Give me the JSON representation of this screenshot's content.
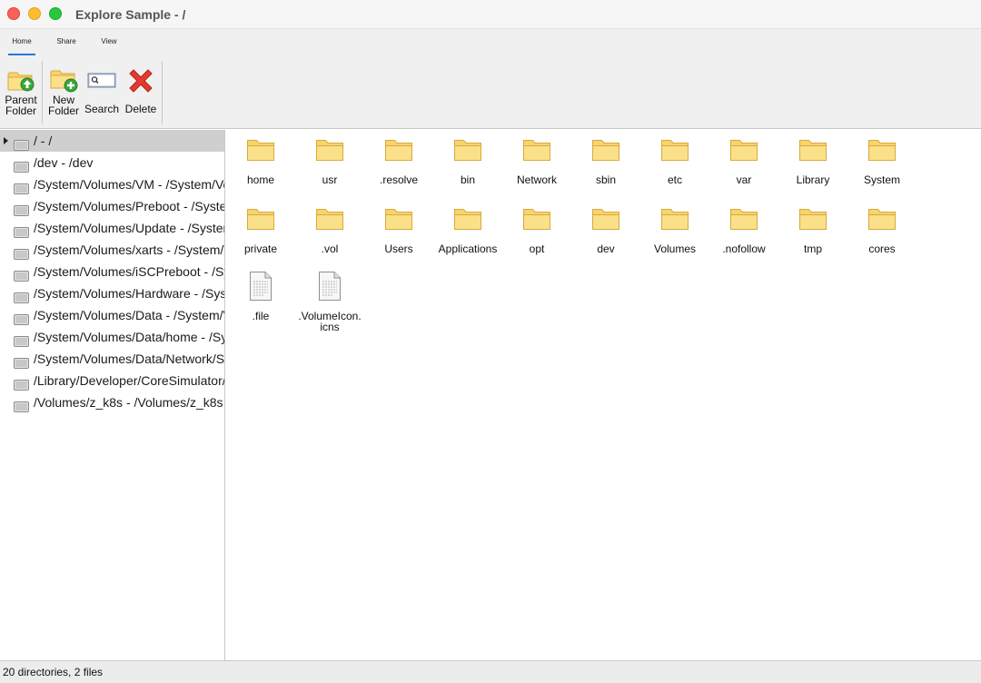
{
  "window": {
    "title": "Explore Sample - /"
  },
  "ribbon": {
    "tabs": [
      {
        "label": "Home",
        "active": true
      },
      {
        "label": "Share",
        "active": false
      },
      {
        "label": "View",
        "active": false
      }
    ],
    "buttons": {
      "parent_line1": "Parent",
      "parent_line2": "Folder",
      "new_line1": "New",
      "new_line2": "Folder",
      "search": "Search",
      "delete": "Delete"
    }
  },
  "tree": {
    "items": [
      {
        "label": "/ - /",
        "selected": true
      },
      {
        "label": "/dev - /dev"
      },
      {
        "label": "/System/Volumes/VM - /System/Volumes/VM"
      },
      {
        "label": "/System/Volumes/Preboot - /System/Volumes/Preboot"
      },
      {
        "label": "/System/Volumes/Update - /System/Volumes/Update"
      },
      {
        "label": "/System/Volumes/xarts - /System/Volumes/xarts"
      },
      {
        "label": "/System/Volumes/iSCPreboot - /System/Volumes/iSCPreboot"
      },
      {
        "label": "/System/Volumes/Hardware - /System/Volumes/Hardware"
      },
      {
        "label": "/System/Volumes/Data - /System/Volumes/Data"
      },
      {
        "label": "/System/Volumes/Data/home - /System/Volumes/Data/home"
      },
      {
        "label": "/System/Volumes/Data/Network/Server"
      },
      {
        "label": "/Library/Developer/CoreSimulator/"
      },
      {
        "label": "/Volumes/z_k8s - /Volumes/z_k8s"
      }
    ]
  },
  "files": {
    "items": [
      {
        "name": "home",
        "kind": "folder"
      },
      {
        "name": "usr",
        "kind": "folder"
      },
      {
        "name": ".resolve",
        "kind": "folder"
      },
      {
        "name": "bin",
        "kind": "folder"
      },
      {
        "name": "Network",
        "kind": "folder"
      },
      {
        "name": "sbin",
        "kind": "folder"
      },
      {
        "name": "etc",
        "kind": "folder"
      },
      {
        "name": "var",
        "kind": "folder"
      },
      {
        "name": "Library",
        "kind": "folder"
      },
      {
        "name": "System",
        "kind": "folder"
      },
      {
        "name": "private",
        "kind": "folder"
      },
      {
        "name": ".vol",
        "kind": "folder"
      },
      {
        "name": "Users",
        "kind": "folder"
      },
      {
        "name": "Applications",
        "kind": "folder"
      },
      {
        "name": "opt",
        "kind": "folder"
      },
      {
        "name": "dev",
        "kind": "folder"
      },
      {
        "name": "Volumes",
        "kind": "folder"
      },
      {
        "name": ".nofollow",
        "kind": "folder"
      },
      {
        "name": "tmp",
        "kind": "folder"
      },
      {
        "name": "cores",
        "kind": "folder"
      },
      {
        "name": ".file",
        "kind": "file"
      },
      {
        "name": ".VolumeIcon.\nicns",
        "kind": "file"
      }
    ]
  },
  "status": {
    "text": "20 directories, 2 files"
  },
  "colors": {
    "folder": "#f8d46e",
    "folder_edge": "#d9a93a",
    "accent": "#2b78d6",
    "selection": "#cfcfcf",
    "delete": "#e23b2e",
    "add": "#3aa53a"
  }
}
